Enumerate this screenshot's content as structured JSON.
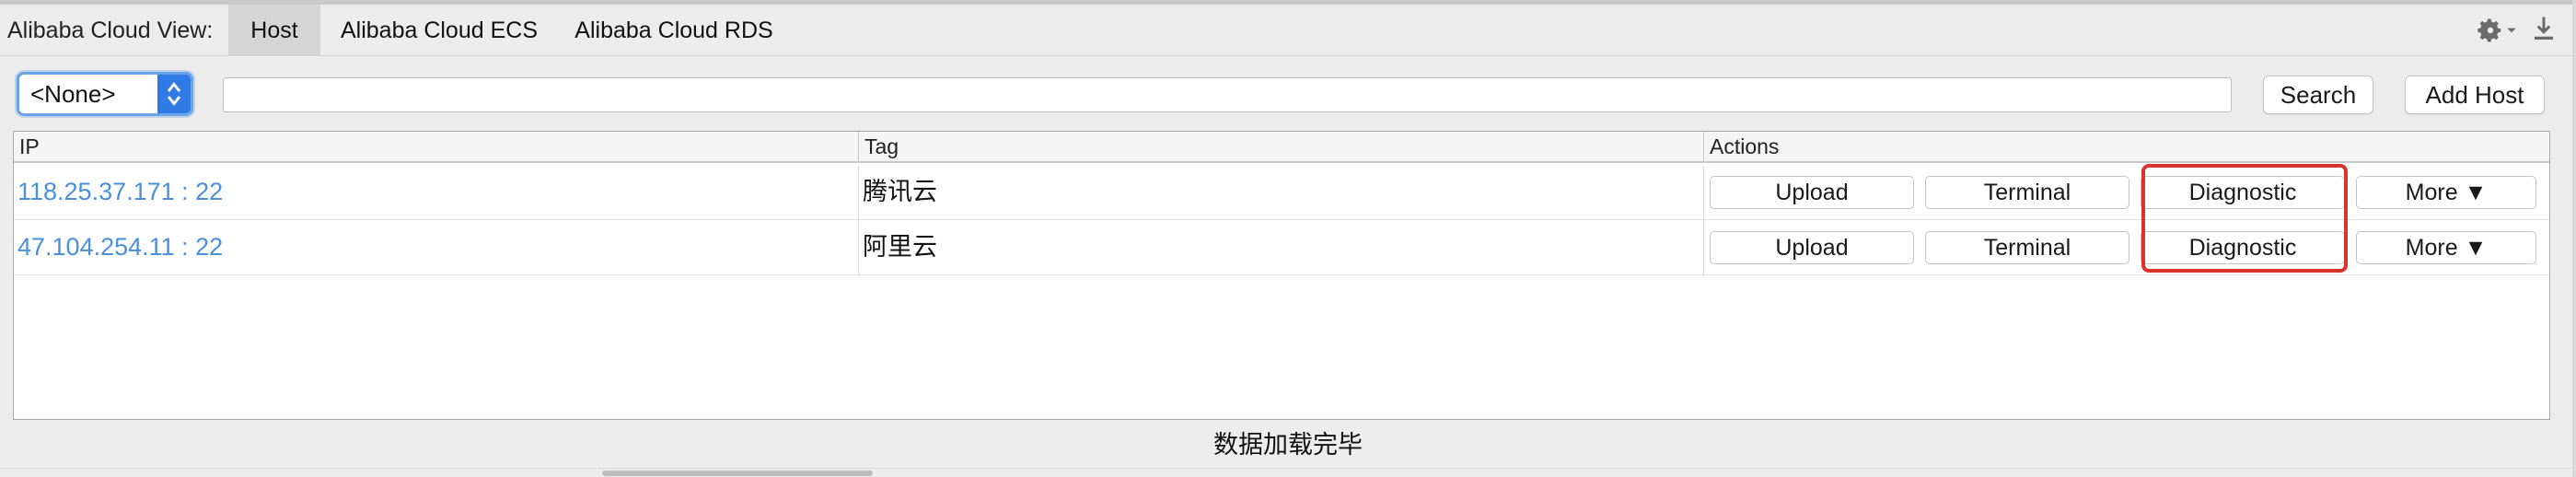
{
  "tabbar": {
    "view_label": "Alibaba Cloud View:",
    "tabs": [
      {
        "label": "Host",
        "active": true
      },
      {
        "label": "Alibaba Cloud ECS",
        "active": false
      },
      {
        "label": "Alibaba Cloud RDS",
        "active": false
      }
    ],
    "icons": [
      "gear-icon",
      "download-icon"
    ]
  },
  "filter": {
    "select_value": "<None>",
    "search_value": "",
    "search_label": "Search",
    "add_host_label": "Add Host"
  },
  "table": {
    "columns": [
      "IP",
      "Tag",
      "Actions"
    ],
    "rows": [
      {
        "ip": "118.25.37.171 : 22",
        "tag": "腾讯云"
      },
      {
        "ip": "47.104.254.11 : 22",
        "tag": "阿里云"
      }
    ],
    "actions": {
      "upload": "Upload",
      "terminal": "Terminal",
      "diagnostic": "Diagnostic",
      "more": "More ▼"
    }
  },
  "status": "数据加载完毕",
  "colors": {
    "accent": "#2f7ae5",
    "link": "#4a8fdc",
    "highlight": "#d9342b"
  }
}
